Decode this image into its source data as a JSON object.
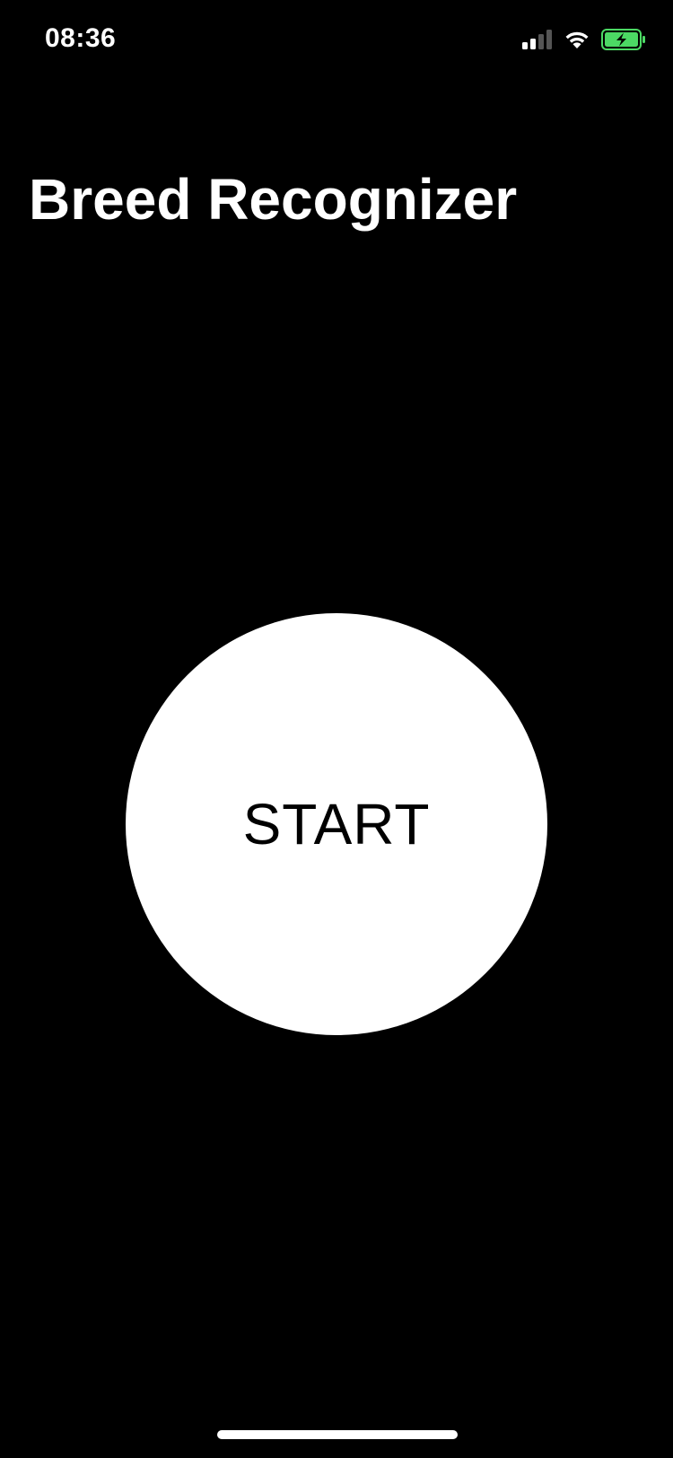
{
  "status_bar": {
    "time": "08:36",
    "signal_icon": "cellular-signal-icon",
    "wifi_icon": "wifi-icon",
    "battery_icon": "battery-charging-icon",
    "battery_color": "#4cd964",
    "signal_bars_active": 2,
    "signal_bars_total": 4
  },
  "header": {
    "title": "Breed Recognizer"
  },
  "main": {
    "start_button_label": "START"
  },
  "colors": {
    "background": "#000000",
    "foreground": "#ffffff",
    "button_text": "#000000"
  }
}
